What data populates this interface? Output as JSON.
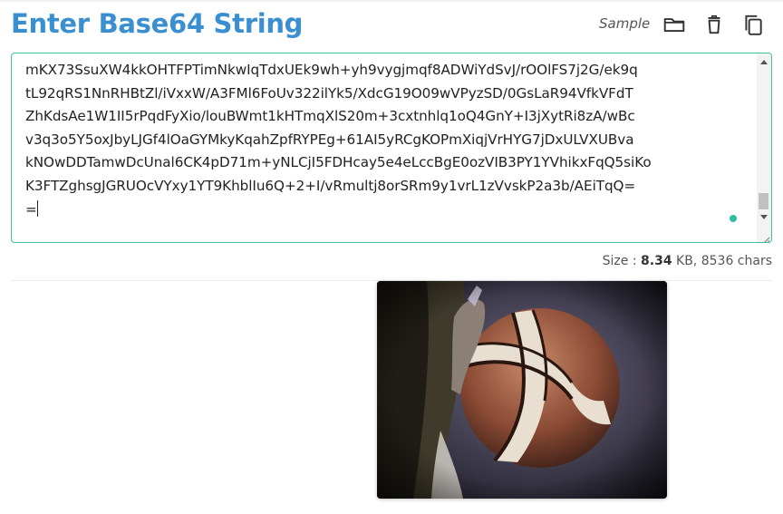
{
  "header": {
    "title": "Enter Base64 String",
    "sample_label": "Sample",
    "icons": [
      "folder-open-icon",
      "trash-icon",
      "copy-icon"
    ]
  },
  "editor": {
    "lines": [
      "mKX73SsuXW4kkOHTFPTimNkwIqTdxUEk9wh+yh9vygjmqf8ADWiYdSvJ/rOOlFS7j2G/ek9q",
      "tL92qRS1NnRHBtZl/iVxxW/A3FMl6FoUv322ilYk5/XdcG19O09wVPyzSD/0GsLaR94VfkVFdT",
      "ZhKdsAe1W1II5rPqdFyXio/louBWmt1kHTmqXlS20m+3cxtnhlq1oQ4GnY+I3jXytRi8zA/wBc",
      "v3q3o5Y5oxJbyLJGf4lOaGYMkyKqahZpfRYPEg+61AI5yRCgKOPmXiqjVrHYG7jDxULVXUBva",
      "kNOwDDTamwDcUnal6CK4pD71m+yNLCjI5FDHcay5e4eLccBgE0ozVIB3PY1YVhikxFqQ5siKo",
      "K3FTZghsgJGRUOcVYxy1YT9KhblIu6Q+2+I/vRmultj8orSRm9y1vrL1zVvskP2a3b/AEiTqQ=",
      "="
    ]
  },
  "size": {
    "label": "Size :",
    "value": "8.34",
    "unit": "KB,",
    "chars": "8536 chars"
  },
  "preview": {
    "icon": "decoded-image-preview"
  },
  "colors": {
    "title": "#3a8fd1",
    "editor_border": "#3dbfa4",
    "status_dot": "#2ebfa0"
  }
}
